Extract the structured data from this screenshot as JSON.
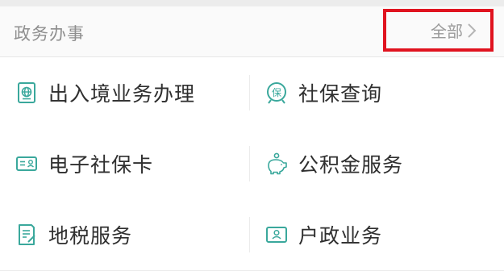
{
  "header": {
    "title": "政务办事",
    "all_label": "全部"
  },
  "services": {
    "r1": {
      "left": {
        "label": "出入境业务办理",
        "icon": "passport-icon"
      },
      "right": {
        "label": "社保查询",
        "icon": "social-security-icon"
      }
    },
    "r2": {
      "left": {
        "label": "电子社保卡",
        "icon": "id-card-icon"
      },
      "right": {
        "label": "公积金服务",
        "icon": "piggy-bank-icon"
      }
    },
    "r3": {
      "left": {
        "label": "地税服务",
        "icon": "tax-document-icon"
      },
      "right": {
        "label": "户政业务",
        "icon": "household-register-icon"
      }
    }
  },
  "colors": {
    "icon_teal": "#3aa89c",
    "highlight_red": "#e0131f",
    "text": "#2f2f2f",
    "muted": "#8f8f8f"
  }
}
